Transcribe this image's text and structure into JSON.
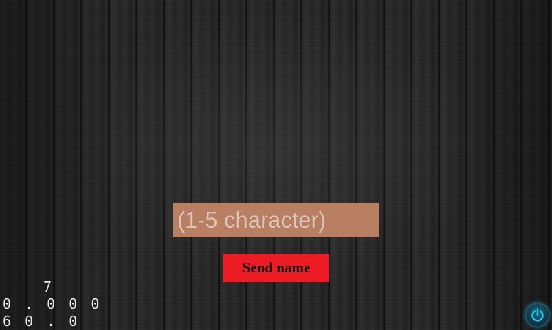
{
  "name_form": {
    "input_value": "",
    "input_placeholder": "(1-5 character)",
    "send_label": "Send name"
  },
  "stats": {
    "line1": "7",
    "line2": "0.000",
    "line3": "60.0"
  },
  "power": {
    "icon": "power-icon",
    "accent_color": "#29c6f0"
  },
  "colors": {
    "input_bg": "#b97f62",
    "button_bg": "#ed1c24"
  }
}
